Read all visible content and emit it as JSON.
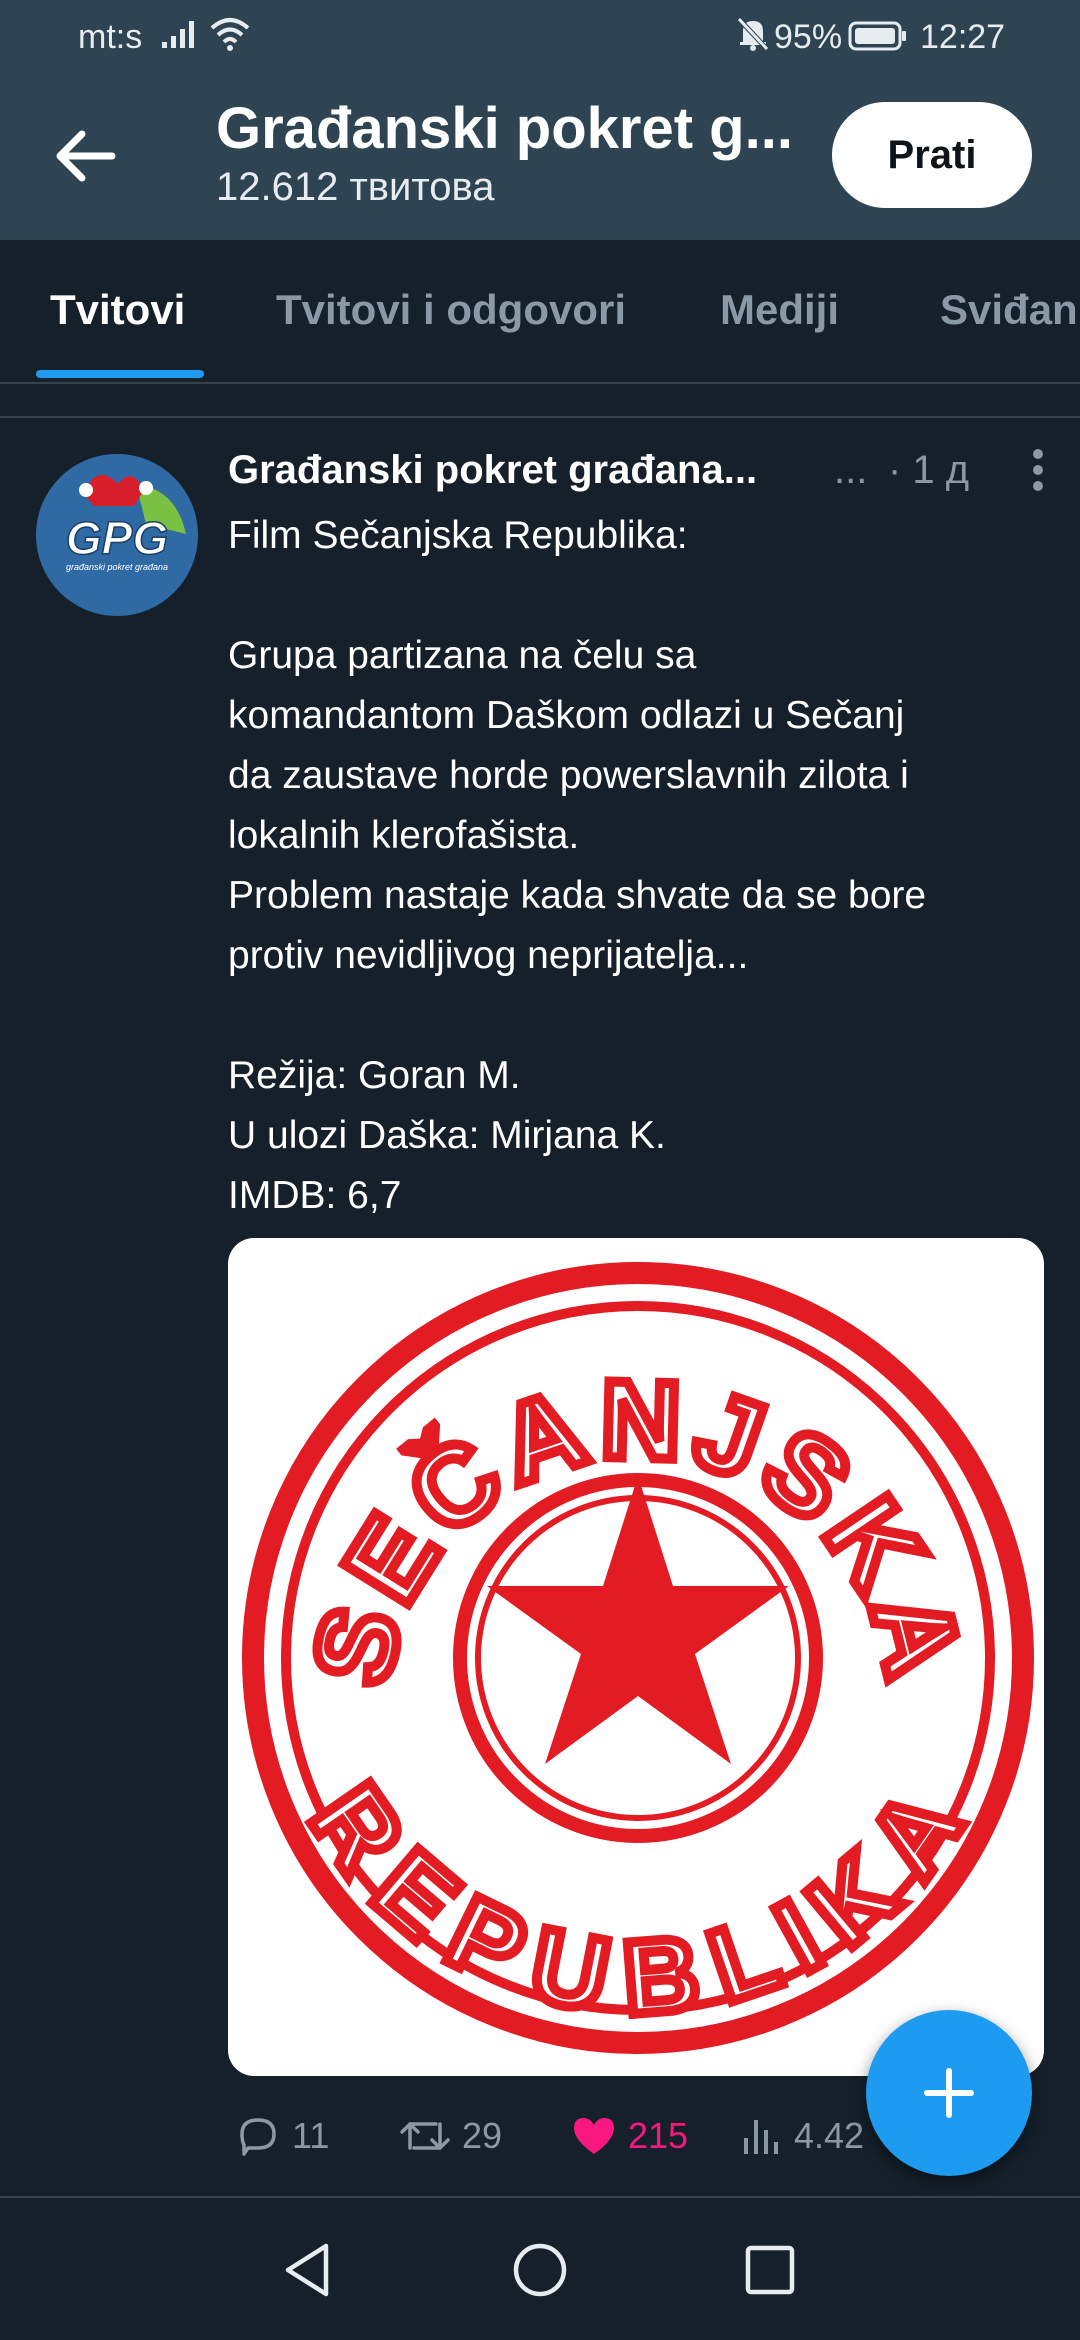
{
  "status_bar": {
    "carrier": "mt:s",
    "battery_percent": "95%",
    "time": "12:27"
  },
  "header": {
    "title": "Građanski pokret g...",
    "subtitle": "12.612 твитова",
    "follow_label": "Prati"
  },
  "tabs": [
    {
      "label": "Tvitovi",
      "active": true
    },
    {
      "label": "Tvitovi i odgovori",
      "active": false
    },
    {
      "label": "Mediji",
      "active": false
    },
    {
      "label": "Sviđan",
      "active": false
    }
  ],
  "tweet": {
    "author": "Građanski pokret građana...",
    "author_extra": "...",
    "time": "· 1 д",
    "avatar_text": "GPG",
    "avatar_subtext": "građanski pokret građana",
    "lines": [
      "Film Sečanjska Republika:",
      "",
      "Grupa partizana na čelu sa",
      "komandantom Daškom odlazi u Sečanj",
      "da zaustave horde powerslavnih zilota i",
      "lokalnih klerofašista.",
      "Problem nastaje kada shvate da se bore",
      "protiv nevidljivog neprijatelja...",
      "",
      "Režija: Goran M.",
      "U ulozi Daška: Mirjana K.",
      "IMDB: 6,7"
    ],
    "image_text_top": "SEČANJSKA",
    "image_text_bottom": "REPUBLIKA",
    "stats": {
      "replies": "11",
      "retweets": "29",
      "likes": "215",
      "views": "4.42"
    }
  },
  "colors": {
    "header_bg": "#2e4453",
    "page_bg": "#15202b",
    "accent": "#1d9bf0",
    "like": "#f91880",
    "stamp_red": "#e31b23"
  }
}
